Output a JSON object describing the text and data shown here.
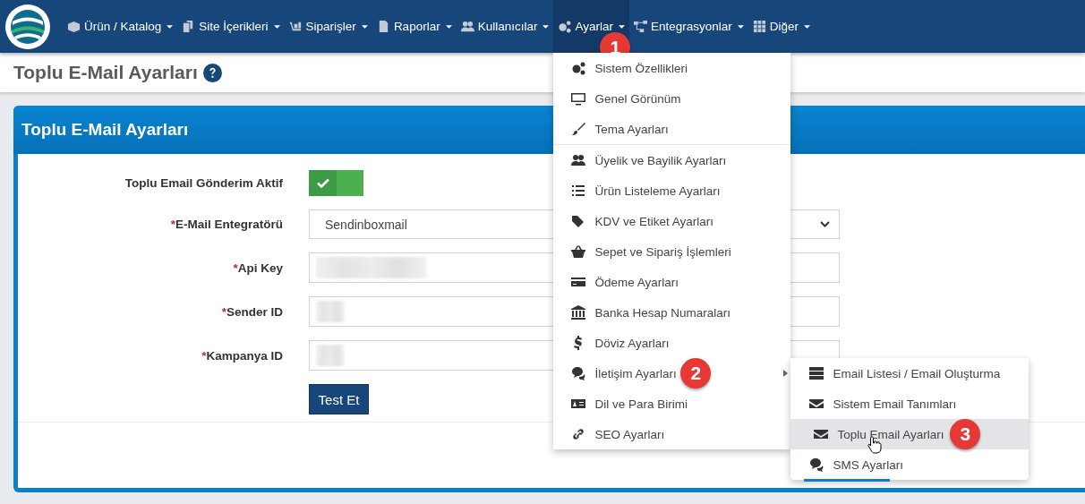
{
  "nav": {
    "items": [
      {
        "label": "Ürün / Katalog",
        "selected": false
      },
      {
        "label": "Site İçerikleri",
        "selected": false
      },
      {
        "label": "Siparişler",
        "selected": false
      },
      {
        "label": "Raporlar",
        "selected": false
      },
      {
        "label": "Kullanıcılar",
        "selected": false
      },
      {
        "label": "Ayarlar",
        "selected": true,
        "badge": "1"
      },
      {
        "label": "Entegrasyonlar",
        "selected": false
      },
      {
        "label": "Diğer",
        "selected": false
      }
    ]
  },
  "page_title": "Toplu E-Mail Ayarları",
  "card": {
    "title": "Toplu E-Mail Ayarları",
    "fields": [
      {
        "kind": "toggle",
        "label": "Toplu Email Gönderim Aktif",
        "on": true
      },
      {
        "kind": "select",
        "mark": "*",
        "label": "E-Mail Entegratörü",
        "value": "Sendinboxmail"
      },
      {
        "kind": "masked",
        "mark": "*",
        "label": "Api Key"
      },
      {
        "kind": "masked",
        "mark": "*",
        "label": "Sender ID"
      },
      {
        "kind": "masked",
        "mark": "*",
        "label": "Kampanya ID"
      }
    ],
    "button": "Test Et"
  },
  "menu": {
    "groups": [
      [
        {
          "label": "Sistem Özellikleri"
        },
        {
          "label": "Genel Görünüm"
        },
        {
          "label": "Tema Ayarları"
        }
      ],
      [
        {
          "label": "Üyelik ve Bayilik Ayarları"
        },
        {
          "label": "Ürün Listeleme Ayarları"
        },
        {
          "label": "KDV ve Etiket Ayarları"
        },
        {
          "label": "Sepet ve Sipariş İşlemleri"
        },
        {
          "label": "Ödeme Ayarları"
        },
        {
          "label": "Banka Hesap Numaraları"
        },
        {
          "label": "Döviz Ayarları"
        },
        {
          "label": "İletişim Ayarları",
          "badge": "2",
          "submenu": true
        },
        {
          "label": "Dil ve Para Birimi"
        },
        {
          "label": "SEO Ayarları"
        }
      ]
    ]
  },
  "submenu": {
    "items": [
      {
        "label": "Email Listesi / Email Oluşturma",
        "selected": false
      },
      {
        "label": "Sistem Email Tanımları",
        "selected": false
      },
      {
        "label": "Toplu Email Ayarları",
        "selected": true,
        "badge": "3"
      },
      {
        "label": "SMS Ayarları",
        "selected": false
      }
    ]
  }
}
